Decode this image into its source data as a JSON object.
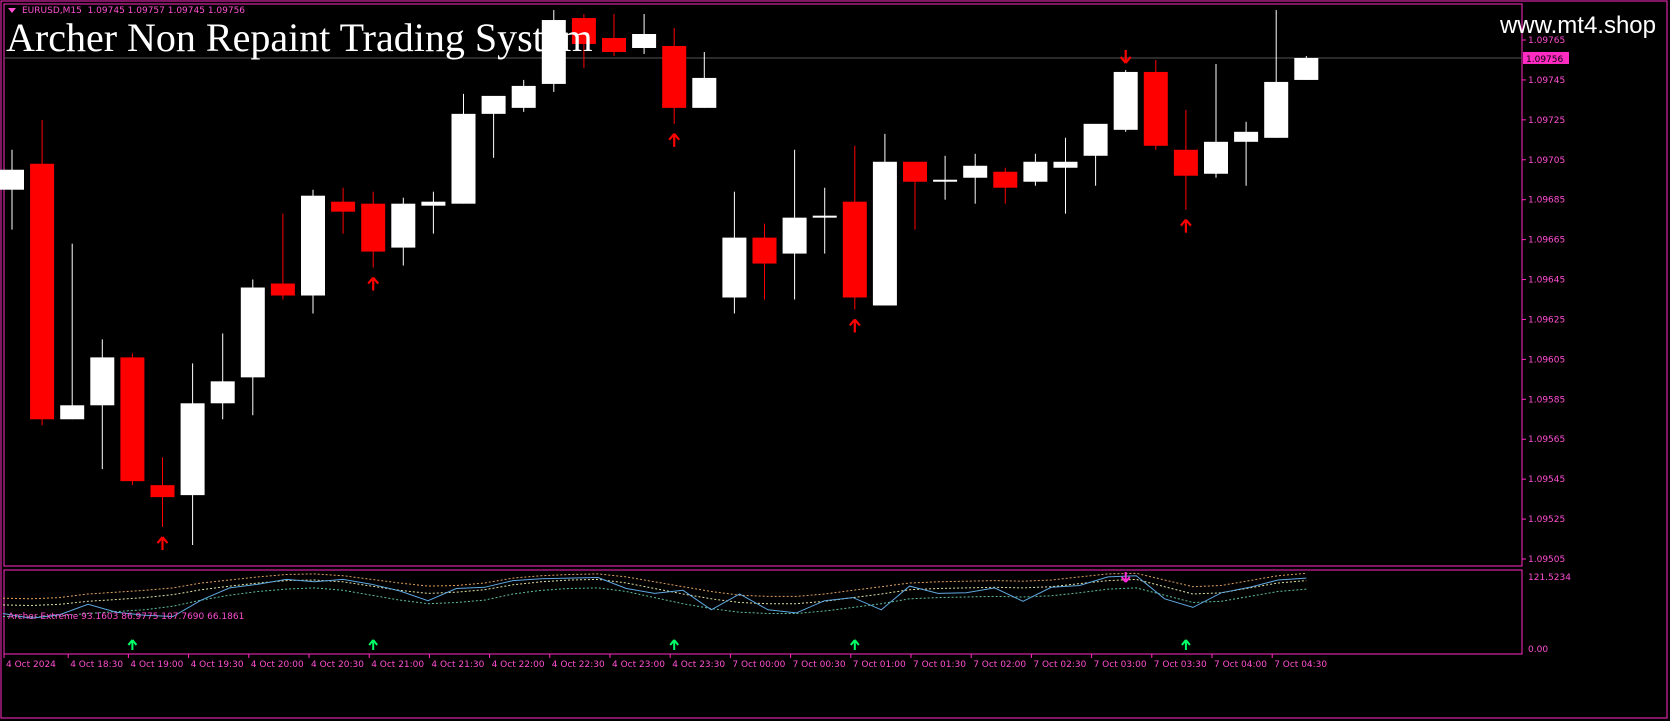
{
  "header": {
    "symbol": "EURUSD,M15",
    "ohlc": "1.09745 1.09757 1.09745 1.09756",
    "overlay_title": "Archer Non Repaint Trading System",
    "watermark": "www.mt4.shop"
  },
  "indicator": {
    "label": "Archer Extreme 93.1603 86.9775 107.7690 66.1861",
    "scale_top": "121.5234",
    "scale_bottom": "0.00"
  },
  "colors": {
    "background": "#000000",
    "bull": "#ffffff",
    "bear": "#ff0000",
    "frame": "#ff2bc2",
    "price_tag": "#ff2bc2",
    "axis_text": "#ff4fd2",
    "signal_main": "#ff0000",
    "signal_ind_up": "#00ff66",
    "signal_ind_down": "#ff2bd6",
    "osc_line": "#5fa8e0",
    "band_upper": "#e0a060",
    "band_mid": "#e0e0a0",
    "band_lower": "#60c0a0"
  },
  "chart_data": [
    {
      "type": "candlestick",
      "series_name": "EURUSD,M15",
      "price_ylim": [
        1.09497,
        1.0979
      ],
      "current_price": 1.09756,
      "y_tick_labels": [
        "1.09765",
        "1.09745",
        "1.09725",
        "1.09705",
        "1.09685",
        "1.09665",
        "1.09645",
        "1.09625",
        "1.09605",
        "1.09585",
        "1.09565",
        "1.09545",
        "1.09525",
        "1.09505"
      ],
      "y_ticks": [
        1.09765,
        1.09745,
        1.09725,
        1.09705,
        1.09685,
        1.09665,
        1.09645,
        1.09625,
        1.09605,
        1.09585,
        1.09565,
        1.09545,
        1.09525,
        1.09505
      ],
      "current_price_label": "1.09756",
      "x_labels": [
        {
          "index": 0,
          "label": "4 Oct 2024"
        },
        {
          "index": 2,
          "label": "4 Oct 18:30"
        },
        {
          "index": 4,
          "label": "4 Oct 19:00"
        },
        {
          "index": 6,
          "label": "4 Oct 19:30"
        },
        {
          "index": 8,
          "label": "4 Oct 20:00"
        },
        {
          "index": 10,
          "label": "4 Oct 20:30"
        },
        {
          "index": 12,
          "label": "4 Oct 21:00"
        },
        {
          "index": 14,
          "label": "4 Oct 21:30"
        },
        {
          "index": 16,
          "label": "4 Oct 22:00"
        },
        {
          "index": 18,
          "label": "4 Oct 22:30"
        },
        {
          "index": 20,
          "label": "4 Oct 23:00"
        },
        {
          "index": 22,
          "label": "4 Oct 23:30"
        },
        {
          "index": 24,
          "label": "7 Oct 00:00"
        },
        {
          "index": 26,
          "label": "7 Oct 00:30"
        },
        {
          "index": 28,
          "label": "7 Oct 01:00"
        },
        {
          "index": 30,
          "label": "7 Oct 01:30"
        },
        {
          "index": 32,
          "label": "7 Oct 02:00"
        },
        {
          "index": 34,
          "label": "7 Oct 02:30"
        },
        {
          "index": 36,
          "label": "7 Oct 03:00"
        },
        {
          "index": 38,
          "label": "7 Oct 03:30"
        },
        {
          "index": 40,
          "label": "7 Oct 04:00"
        },
        {
          "index": 42,
          "label": "7 Oct 04:30"
        }
      ],
      "candles": [
        {
          "o": 1.0969,
          "h": 1.0971,
          "l": 1.0967,
          "c": 1.097
        },
        {
          "o": 1.09703,
          "h": 1.09725,
          "l": 1.09572,
          "c": 1.09575
        },
        {
          "o": 1.09575,
          "h": 1.09663,
          "l": 1.09575,
          "c": 1.09582
        },
        {
          "o": 1.09582,
          "h": 1.09615,
          "l": 1.0955,
          "c": 1.09606
        },
        {
          "o": 1.09606,
          "h": 1.09608,
          "l": 1.09542,
          "c": 1.09544
        },
        {
          "o": 1.09542,
          "h": 1.09556,
          "l": 1.09521,
          "c": 1.09536
        },
        {
          "o": 1.09537,
          "h": 1.09603,
          "l": 1.09512,
          "c": 1.09583
        },
        {
          "o": 1.09583,
          "h": 1.09618,
          "l": 1.09575,
          "c": 1.09594
        },
        {
          "o": 1.09596,
          "h": 1.09645,
          "l": 1.09577,
          "c": 1.09641
        },
        {
          "o": 1.09643,
          "h": 1.09678,
          "l": 1.09635,
          "c": 1.09637
        },
        {
          "o": 1.09637,
          "h": 1.0969,
          "l": 1.09628,
          "c": 1.09687
        },
        {
          "o": 1.09684,
          "h": 1.09691,
          "l": 1.09668,
          "c": 1.09679
        },
        {
          "o": 1.09683,
          "h": 1.09689,
          "l": 1.09651,
          "c": 1.09659
        },
        {
          "o": 1.09661,
          "h": 1.09686,
          "l": 1.09652,
          "c": 1.09683
        },
        {
          "o": 1.09682,
          "h": 1.09689,
          "l": 1.09668,
          "c": 1.09684
        },
        {
          "o": 1.09683,
          "h": 1.09738,
          "l": 1.09683,
          "c": 1.09728
        },
        {
          "o": 1.09728,
          "h": 1.09735,
          "l": 1.09706,
          "c": 1.09737
        },
        {
          "o": 1.09731,
          "h": 1.09745,
          "l": 1.09729,
          "c": 1.09742
        },
        {
          "o": 1.09743,
          "h": 1.0978,
          "l": 1.09739,
          "c": 1.09775
        },
        {
          "o": 1.09776,
          "h": 1.09778,
          "l": 1.09751,
          "c": 1.09763
        },
        {
          "o": 1.09766,
          "h": 1.09778,
          "l": 1.09757,
          "c": 1.09759
        },
        {
          "o": 1.09761,
          "h": 1.09778,
          "l": 1.09758,
          "c": 1.09768
        },
        {
          "o": 1.09762,
          "h": 1.09771,
          "l": 1.09723,
          "c": 1.09731
        },
        {
          "o": 1.09731,
          "h": 1.09759,
          "l": 1.09731,
          "c": 1.09746
        },
        {
          "o": 1.09636,
          "h": 1.09689,
          "l": 1.09628,
          "c": 1.09666
        },
        {
          "o": 1.09666,
          "h": 1.09673,
          "l": 1.09635,
          "c": 1.09653
        },
        {
          "o": 1.09658,
          "h": 1.0971,
          "l": 1.09635,
          "c": 1.09676
        },
        {
          "o": 1.09677,
          "h": 1.09691,
          "l": 1.09658,
          "c": 1.09677
        },
        {
          "o": 1.09684,
          "h": 1.09712,
          "l": 1.0963,
          "c": 1.09636
        },
        {
          "o": 1.09632,
          "h": 1.09718,
          "l": 1.09632,
          "c": 1.09704
        },
        {
          "o": 1.09704,
          "h": 1.09704,
          "l": 1.0967,
          "c": 1.09694
        },
        {
          "o": 1.09694,
          "h": 1.09707,
          "l": 1.09685,
          "c": 1.09695
        },
        {
          "o": 1.09696,
          "h": 1.09708,
          "l": 1.09683,
          "c": 1.09702
        },
        {
          "o": 1.09699,
          "h": 1.09701,
          "l": 1.09683,
          "c": 1.09691
        },
        {
          "o": 1.09694,
          "h": 1.09708,
          "l": 1.09692,
          "c": 1.09704
        },
        {
          "o": 1.09701,
          "h": 1.09716,
          "l": 1.09678,
          "c": 1.09704
        },
        {
          "o": 1.09707,
          "h": 1.09722,
          "l": 1.09692,
          "c": 1.09723
        },
        {
          "o": 1.0972,
          "h": 1.0975,
          "l": 1.09719,
          "c": 1.09749
        },
        {
          "o": 1.09749,
          "h": 1.09755,
          "l": 1.0971,
          "c": 1.09712
        },
        {
          "o": 1.0971,
          "h": 1.0973,
          "l": 1.0968,
          "c": 1.09697
        },
        {
          "o": 1.09698,
          "h": 1.09753,
          "l": 1.09696,
          "c": 1.09714
        },
        {
          "o": 1.09714,
          "h": 1.09724,
          "l": 1.09692,
          "c": 1.09719
        },
        {
          "o": 1.09716,
          "h": 1.0978,
          "l": 1.09716,
          "c": 1.09744
        },
        {
          "o": 1.09745,
          "h": 1.09757,
          "l": 1.09745,
          "c": 1.09756
        }
      ],
      "signals": [
        {
          "index": 5,
          "type": "up"
        },
        {
          "index": 12,
          "type": "up"
        },
        {
          "index": 22,
          "type": "up"
        },
        {
          "index": 28,
          "type": "up"
        },
        {
          "index": 37,
          "type": "down"
        },
        {
          "index": 39,
          "type": "up"
        }
      ]
    },
    {
      "type": "line",
      "series_name": "Archer Extreme",
      "ylim": [
        0,
        121.5234
      ],
      "y_tick_labels": [
        "121.5234",
        "0.00"
      ],
      "line": [
        60,
        52,
        58,
        75,
        62,
        57,
        55,
        82,
        102,
        108,
        116,
        112,
        116,
        108,
        97,
        81,
        101,
        103,
        114,
        117,
        118,
        119,
        101,
        93,
        98,
        66,
        92,
        66,
        61,
        81,
        86,
        66,
        105,
        93,
        94,
        102,
        80,
        103,
        106,
        120,
        122,
        84,
        70,
        94,
        103,
        115,
        118
      ],
      "band_upper": [
        85,
        84,
        86,
        92,
        95,
        98,
        102,
        110,
        115,
        120,
        124,
        125,
        122,
        116,
        110,
        105,
        106,
        110,
        118,
        122,
        124,
        125,
        120,
        112,
        104,
        96,
        90,
        88,
        88,
        92,
        98,
        104,
        110,
        112,
        113,
        114,
        113,
        115,
        120,
        125,
        126,
        115,
        104,
        106,
        114,
        122,
        126
      ],
      "band_mid": [
        74,
        73,
        75,
        80,
        83,
        86,
        91,
        99,
        105,
        110,
        114,
        115,
        112,
        105,
        98,
        93,
        95,
        99,
        107,
        112,
        115,
        116,
        110,
        101,
        92,
        84,
        78,
        76,
        76,
        80,
        86,
        92,
        99,
        101,
        102,
        103,
        102,
        104,
        109,
        114,
        116,
        104,
        92,
        94,
        102,
        110,
        114
      ],
      "band_lower": [
        55,
        54,
        56,
        60,
        63,
        66,
        72,
        82,
        90,
        96,
        100,
        102,
        98,
        90,
        82,
        76,
        78,
        82,
        92,
        98,
        101,
        102,
        96,
        86,
        76,
        68,
        62,
        60,
        60,
        64,
        70,
        76,
        84,
        86,
        87,
        88,
        87,
        89,
        94,
        100,
        102,
        90,
        78,
        80,
        88,
        96,
        100
      ],
      "signals": [
        {
          "index": 4,
          "type": "up"
        },
        {
          "index": 12,
          "type": "up"
        },
        {
          "index": 22,
          "type": "up"
        },
        {
          "index": 28,
          "type": "up"
        },
        {
          "index": 37,
          "type": "down"
        },
        {
          "index": 39,
          "type": "up"
        }
      ]
    }
  ]
}
